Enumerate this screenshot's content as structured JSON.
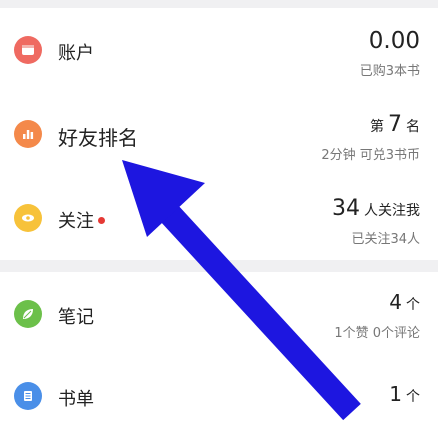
{
  "account": {
    "label": "账户",
    "value": "0.00",
    "sub": "已购3本书"
  },
  "friends": {
    "label": "好友排名",
    "prefix": "第",
    "rank": "7",
    "suffix": "名",
    "sub": "2分钟 可兑3书币"
  },
  "follow": {
    "label": "关注",
    "count": "34",
    "suffix": "人关注我",
    "sub": "已关注34人"
  },
  "notes": {
    "label": "笔记",
    "count": "4",
    "suffix": "个",
    "sub": "1个赞 0个评论"
  },
  "booklist": {
    "label": "书单",
    "count": "1",
    "suffix": "个"
  },
  "colors": {
    "account_icon": "#ef6a61",
    "friends_icon": "#f4894a",
    "follow_icon": "#f7c23a",
    "notes_icon": "#6cc04a",
    "booklist_icon": "#4a8fe8",
    "dot": "#e53935",
    "arrow": "#1d16e0"
  },
  "icons": [
    "wallet-icon",
    "ranking-bars-icon",
    "eye-icon",
    "leaf-icon",
    "list-icon"
  ]
}
